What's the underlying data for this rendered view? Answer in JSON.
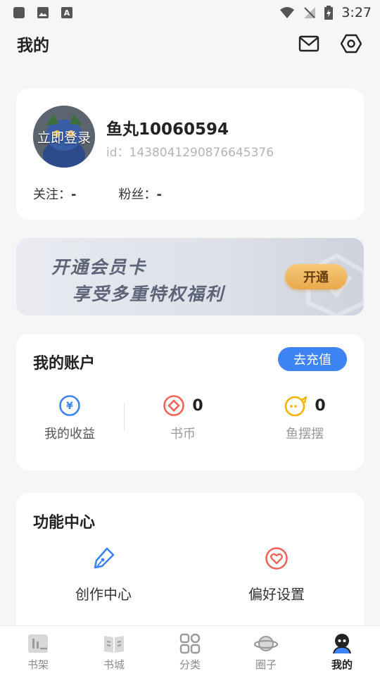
{
  "status_bar": {
    "time": "3:27"
  },
  "header": {
    "title": "我的"
  },
  "profile": {
    "avatar_text": "立即登录",
    "username": "鱼丸10060594",
    "user_id": "id：1438041290876645376",
    "following_label": "关注：",
    "following_value": "-",
    "followers_label": "粉丝：",
    "followers_value": "-"
  },
  "vip": {
    "line1": "开通会员卡",
    "line2": "享受多重特权福利",
    "button": "开通"
  },
  "account": {
    "title": "我的账户",
    "recharge_button": "去充值",
    "items": [
      {
        "label": "我的收益",
        "value": "",
        "icon": "yuan-icon",
        "color": "#3d83f4"
      },
      {
        "label": "书币",
        "value": "0",
        "icon": "book-coin-icon",
        "color": "#f0645c"
      },
      {
        "label": "鱼摆摆",
        "value": "0",
        "icon": "fish-icon",
        "color": "#f5b400"
      }
    ]
  },
  "functions": {
    "title": "功能中心",
    "items": [
      {
        "label": "创作中心",
        "icon": "pen-icon",
        "color": "#3d83f4"
      },
      {
        "label": "偏好设置",
        "icon": "heart-icon",
        "color": "#f0645c"
      }
    ]
  },
  "tabs": [
    {
      "label": "书架",
      "icon": "bookshelf-icon"
    },
    {
      "label": "书城",
      "icon": "bookstore-icon"
    },
    {
      "label": "分类",
      "icon": "category-icon"
    },
    {
      "label": "圈子",
      "icon": "planet-icon"
    },
    {
      "label": "我的",
      "icon": "profile-icon",
      "active": true
    }
  ]
}
